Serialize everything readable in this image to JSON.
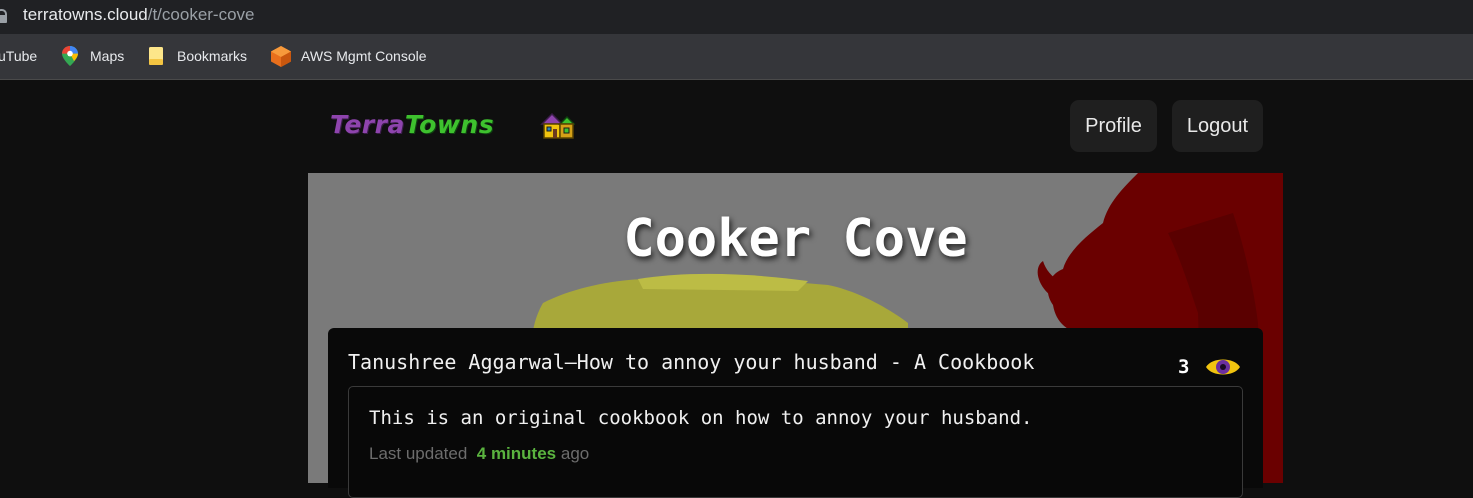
{
  "browser": {
    "url_host": "terratowns.cloud",
    "url_path": "/t/cooker-cove",
    "bookmarks": [
      {
        "label": "uTube",
        "icon": "youtube-icon"
      },
      {
        "label": "Maps",
        "icon": "maps-pin-icon"
      },
      {
        "label": "Bookmarks",
        "icon": "folder-icon"
      },
      {
        "label": "AWS Mgmt Console",
        "icon": "aws-cube-icon"
      }
    ]
  },
  "header": {
    "logo_part1": "Terra",
    "logo_part2": "Towns",
    "profile_label": "Profile",
    "logout_label": "Logout"
  },
  "town": {
    "title": "Cooker Cove"
  },
  "home": {
    "author": "Tanushree Aggarwal",
    "separator": "—",
    "name": "How to annoy your husband - A Cookbook",
    "visits": "3",
    "description": "This is an original cookbook on how to annoy your husband.",
    "updated_prefix": "Last updated",
    "updated_time": "4 minutes",
    "updated_suffix": "ago"
  },
  "colors": {
    "accent_green": "#5ab33f",
    "logo_purple": "#8e44ad",
    "logo_green": "#3ec12e",
    "eye_yellow": "#f1c40f",
    "eye_purple": "#6b2fa0"
  }
}
